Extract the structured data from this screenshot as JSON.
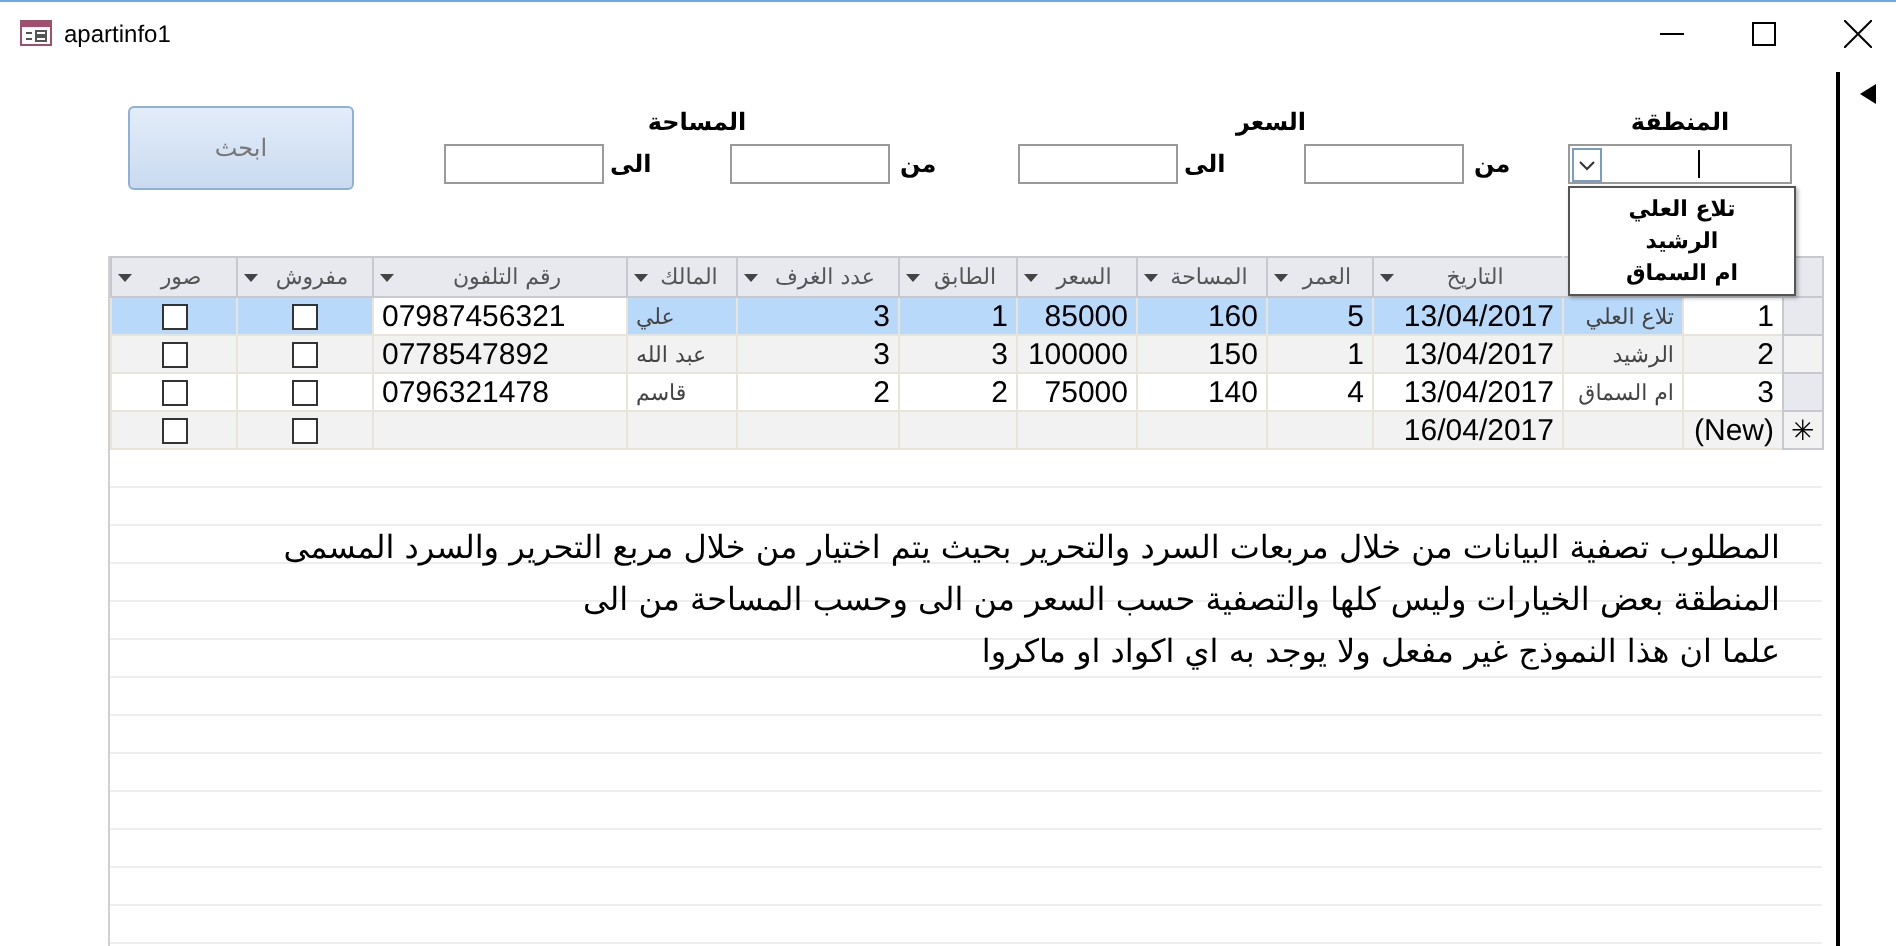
{
  "window": {
    "title": "apartinfo1"
  },
  "search_button": {
    "label": "ابحث"
  },
  "filters": {
    "area": {
      "label": "المساحة",
      "from_label": "من",
      "to_label": "الى"
    },
    "price": {
      "label": "السعر",
      "from_label": "من",
      "to_label": "الى"
    },
    "region": {
      "label": "المنطقة",
      "expanded": true,
      "options": [
        "تلاع العلي",
        "الرشيد",
        "ام السماق"
      ]
    }
  },
  "table": {
    "columns": [
      {
        "kind": "text"
      },
      {
        "kind": "text"
      },
      {
        "kind": "text",
        "label": "التاريخ"
      },
      {
        "kind": "text",
        "label": "العمر"
      },
      {
        "kind": "text",
        "label": "المساحة"
      },
      {
        "kind": "text",
        "label": "السعر"
      },
      {
        "kind": "text",
        "label": "الطابق"
      },
      {
        "kind": "text",
        "label": "عدد الغرف"
      },
      {
        "kind": "text",
        "label": "المالك"
      },
      {
        "kind": "text",
        "label": "رقم التلفون"
      },
      {
        "kind": "check",
        "label": "مفروش"
      },
      {
        "kind": "check",
        "label": "صور"
      }
    ],
    "rows": [
      {
        "id": "1",
        "region": "تلاع العلي",
        "date": "13/04/2017",
        "age": "5",
        "area": "160",
        "price": "85000",
        "floor": "1",
        "rooms": "3",
        "owner": "علي",
        "phone": "07987456321",
        "furnished": false,
        "photos": false,
        "selected": true
      },
      {
        "id": "2",
        "region": "الرشيد",
        "date": "13/04/2017",
        "age": "1",
        "area": "150",
        "price": "100000",
        "floor": "3",
        "rooms": "3",
        "owner": "عبد الله",
        "phone": "0778547892",
        "furnished": false,
        "photos": false,
        "selected": false
      },
      {
        "id": "3",
        "region": "ام السماق",
        "date": "13/04/2017",
        "age": "4",
        "area": "140",
        "price": "75000",
        "floor": "2",
        "rooms": "2",
        "owner": "قاسم",
        "phone": "0796321478",
        "furnished": false,
        "photos": false,
        "selected": false
      },
      {
        "id": "(New)",
        "date": "16/04/2017",
        "furnished": false,
        "photos": false,
        "selected": false,
        "marker": "✳"
      }
    ]
  },
  "notes": [
    "المطلوب تصفية البيانات من خلال مربعات السرد والتحرير بحيث يتم اختيار من خلال مربع التحرير والسرد المسمى",
    "المنطقة بعض الخيارات وليس كلها والتصفية حسب السعر من الى وحسب المساحة من الى",
    "علما ان هذا النموذج غير مفعل ولا يوجد به اي اكواد او ماكروا"
  ]
}
